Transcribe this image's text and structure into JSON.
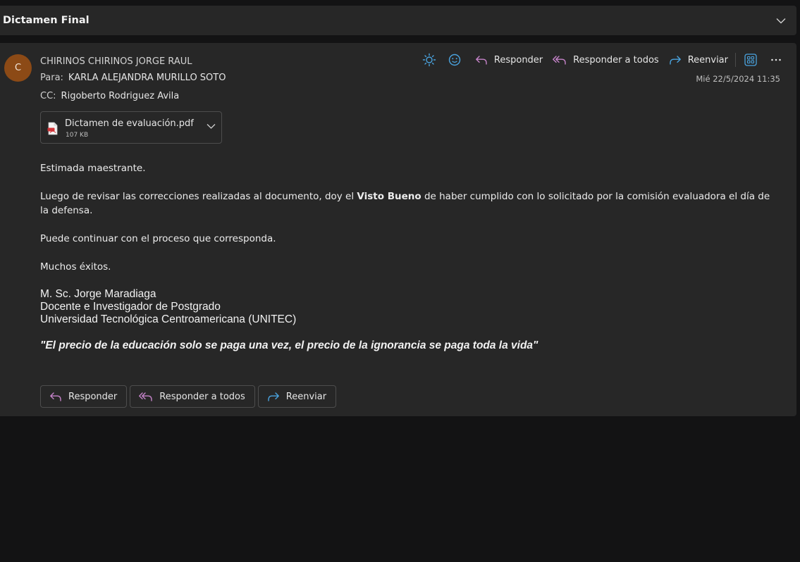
{
  "subject": {
    "title": "Dictamen Final"
  },
  "message": {
    "avatar_initial": "C",
    "sender": "CHIRINOS CHIRINOS JORGE RAUL",
    "to_label": "Para:",
    "to": "KARLA ALEJANDRA MURILLO SOTO",
    "cc_label": "CC:",
    "cc": "Rigoberto Rodriguez Avila",
    "date": "Mié 22/5/2024 11:35"
  },
  "toolbar": {
    "reply_label": "Responder",
    "reply_all_label": "Responder a todos",
    "forward_label": "Reenviar"
  },
  "attachment": {
    "name": "Dictamen de evaluación.pdf",
    "size": "107 KB"
  },
  "body": {
    "greeting": "Estimada maestrante.",
    "para1_before": "Luego de revisar las correcciones realizadas al documento, doy el ",
    "para1_bold": "Visto Bueno",
    "para1_after": " de haber cumplido con lo solicitado por la comisión evaluadora el día de la defensa.",
    "para2": "Puede continuar con el proceso que corresponda.",
    "para3": "Muchos éxitos.",
    "sig_name": "M. Sc. Jorge Maradiaga",
    "sig_title": "Docente e Investigador de Postgrado",
    "sig_org": "Universidad Tecnológica Centroamericana (UNITEC)",
    "quote": "\"El precio de la educación solo se paga una vez, el precio de la ignorancia se paga toda la vida\""
  },
  "actions": {
    "reply": "Responder",
    "reply_all": "Responder a todos",
    "forward": "Reenviar"
  },
  "colors": {
    "accent": "#4aa3df",
    "reply_icon": "#c583c9",
    "avatar": "#8c4a16",
    "background": "#131314",
    "card": "#272727"
  }
}
